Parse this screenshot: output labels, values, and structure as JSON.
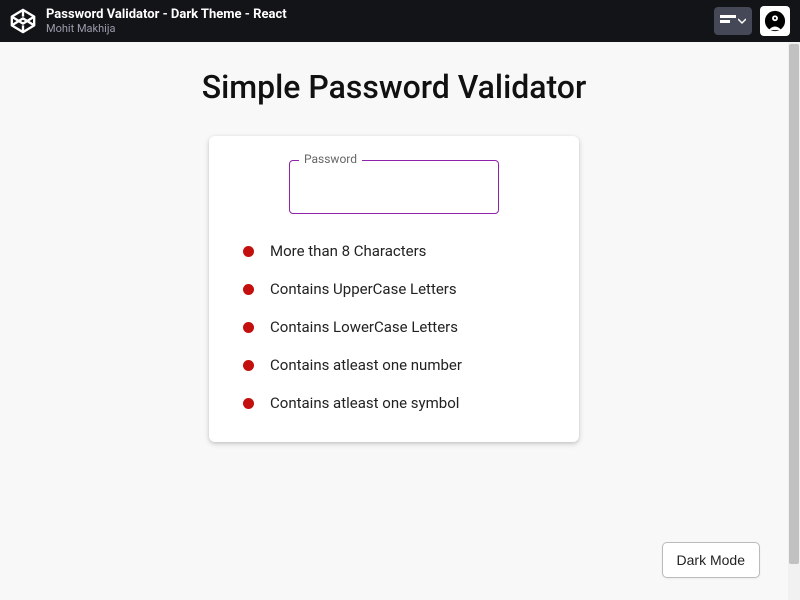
{
  "topbar": {
    "title": "Password Validator - Dark Theme - React",
    "author": "Mohit Makhija"
  },
  "page": {
    "heading": "Simple Password Validator"
  },
  "form": {
    "password_label": "Password",
    "password_value": ""
  },
  "rules": [
    {
      "label": "More than 8 Characters",
      "met": false
    },
    {
      "label": "Contains UpperCase Letters",
      "met": false
    },
    {
      "label": "Contains LowerCase Letters",
      "met": false
    },
    {
      "label": "Contains atleast one number",
      "met": false
    },
    {
      "label": "Contains atleast one symbol",
      "met": false
    }
  ],
  "theme_button": "Dark Mode",
  "colors": {
    "rule_fail": "#c40f0f",
    "input_border": "#8e24aa",
    "topbar_bg": "#131417"
  }
}
